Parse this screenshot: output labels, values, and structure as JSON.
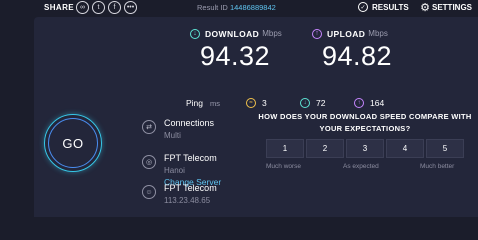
{
  "topbar": {
    "share_label": "SHARE",
    "share_icons": [
      "link-icon",
      "twitter-icon",
      "facebook-icon",
      "more-icon"
    ],
    "result_label": "Result ID",
    "result_id": "14486889842",
    "results_label": "RESULTS",
    "settings_label": "SETTINGS"
  },
  "download": {
    "label": "DOWNLOAD",
    "unit": "Mbps",
    "value": "94.32",
    "color": "#5de3d4"
  },
  "upload": {
    "label": "UPLOAD",
    "unit": "Mbps",
    "value": "94.82",
    "color": "#c685ff"
  },
  "ping": {
    "label": "Ping",
    "unit": "ms",
    "idle": "3",
    "download": "72",
    "upload": "164"
  },
  "go_label": "GO",
  "connections": {
    "title": "Connections",
    "value": "Multi"
  },
  "server": {
    "isp": "FPT Telecom",
    "location": "Hanoi",
    "change_label": "Change Server"
  },
  "host": {
    "isp": "FPT Telecom",
    "ip": "113.23.48.65"
  },
  "compare": {
    "question": "HOW DOES YOUR DOWNLOAD SPEED COMPARE WITH YOUR EXPECTATIONS?",
    "options": [
      "1",
      "2",
      "3",
      "4",
      "5"
    ],
    "low_label": "Much worse",
    "mid_label": "As expected",
    "high_label": "Much better"
  }
}
